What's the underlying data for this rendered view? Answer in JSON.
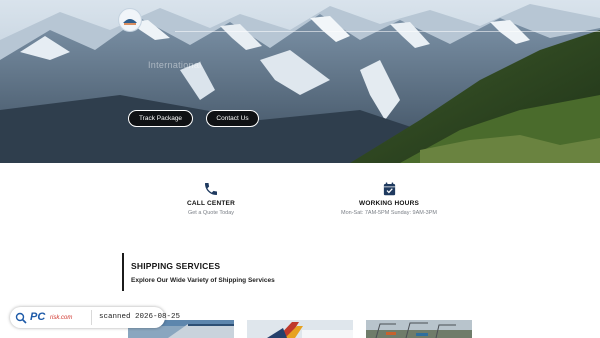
{
  "hero": {
    "subtitle": "International",
    "buttons": {
      "track_label": "Track Package",
      "contact_label": "Contact Us"
    }
  },
  "info": {
    "call": {
      "icon": "phone-icon",
      "title": "CALL CENTER",
      "subtitle": "Get a Quote Today"
    },
    "hours": {
      "icon": "calendar-check-icon",
      "title": "WORKING HOURS",
      "subtitle": "Mon-Sat: 7AM-5PM Sunday: 9AM-3PM"
    }
  },
  "services": {
    "title": "SHIPPING SERVICES",
    "subtitle": "Explore Our Wide Variety of Shipping Services",
    "thumbnails": [
      "warehouse-image",
      "airplane-image",
      "port-cranes-image"
    ]
  },
  "watermark": {
    "brand": "PC",
    "brand_suffix": "risk.com",
    "scan_text": "scanned 2026-08-25"
  },
  "colors": {
    "accent": "#1f3a5f",
    "button_bg": "#0f1114",
    "text_dark": "#161616",
    "text_muted": "#7a7f86"
  }
}
